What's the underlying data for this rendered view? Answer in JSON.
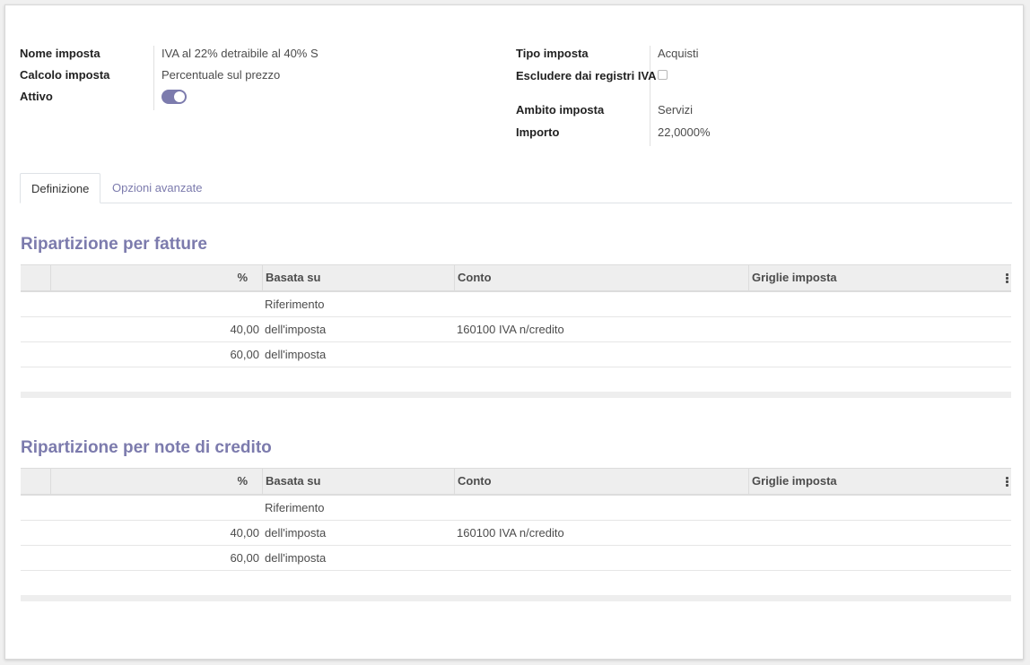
{
  "form": {
    "left": [
      {
        "label": "Nome imposta",
        "value": "IVA al 22% detraibile al 40% S"
      },
      {
        "label": "Calcolo imposta",
        "value": "Percentuale sul prezzo"
      },
      {
        "label": "Attivo",
        "value": ""
      }
    ],
    "right": [
      {
        "label": "Tipo imposta",
        "value": "Acquisti"
      },
      {
        "label": "Escludere dai registri IVA",
        "value": ""
      },
      {
        "label": "Ambito imposta",
        "value": "Servizi"
      },
      {
        "label": "Importo",
        "value": "22,0000%"
      }
    ],
    "active_toggle": true,
    "exclude_checked": false
  },
  "tabs": [
    {
      "label": "Definizione",
      "active": true
    },
    {
      "label": "Opzioni avanzate",
      "active": false
    }
  ],
  "columns": {
    "percent": "%",
    "based_on": "Basata su",
    "account": "Conto",
    "tax_grids": "Griglie imposta"
  },
  "sections": [
    {
      "title": "Ripartizione per fatture",
      "rows": [
        {
          "percent": "",
          "based_on": "Riferimento",
          "account": ""
        },
        {
          "percent": "40,00",
          "based_on": "dell'imposta",
          "account": "160100 IVA n/credito"
        },
        {
          "percent": "60,00",
          "based_on": "dell'imposta",
          "account": ""
        }
      ]
    },
    {
      "title": "Ripartizione per note di credito",
      "rows": [
        {
          "percent": "",
          "based_on": "Riferimento",
          "account": ""
        },
        {
          "percent": "40,00",
          "based_on": "dell'imposta",
          "account": "160100 IVA n/credito"
        },
        {
          "percent": "60,00",
          "based_on": "dell'imposta",
          "account": ""
        }
      ]
    }
  ],
  "colors": {
    "accent": "#7c7bad"
  }
}
